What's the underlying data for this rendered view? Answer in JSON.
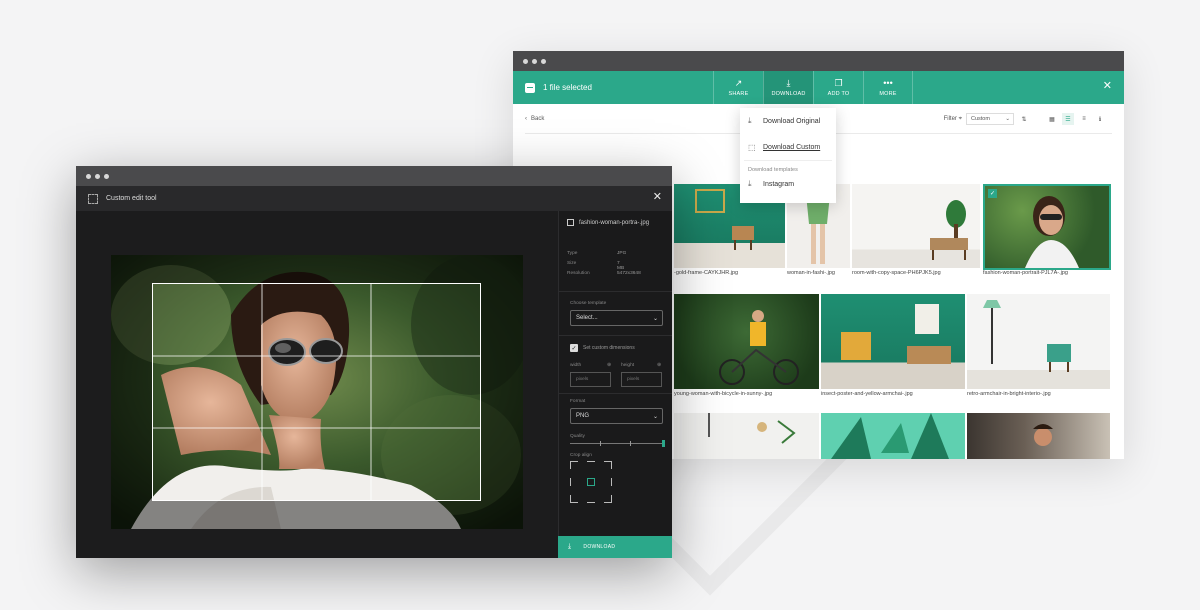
{
  "gallery": {
    "selection_text": "1 file selected",
    "actions": [
      {
        "label": "SHARE",
        "icon": "share-icon"
      },
      {
        "label": "DOWNLOAD",
        "icon": "download-icon"
      },
      {
        "label": "ADD TO",
        "icon": "add-to-icon"
      },
      {
        "label": "MORE",
        "icon": "more-icon"
      }
    ],
    "back_label": "Back",
    "filter_label": "Filter",
    "sort_select_value": "Custom",
    "download_menu": {
      "original": "Download Original",
      "custom": "Download Custom",
      "templates_heading": "Download templates",
      "template_item": "Instagram"
    },
    "items": [
      {
        "caption": "-gold-frame-CAYKJHR.jpg"
      },
      {
        "caption": "woman-in-fashi-.jpg"
      },
      {
        "caption": "room-with-copy-space-PH6PJK5.jpg"
      },
      {
        "caption": "fashion-woman-portrait-PJL7A-.jpg"
      },
      {
        "caption": "young-woman-with-bicycle-in-sunny-.jpg"
      },
      {
        "caption": "insect-poster-and-yellow-armchai-.jpg"
      },
      {
        "caption": "retro-armchair-in-bright-interio-.jpg"
      }
    ]
  },
  "editor": {
    "title": "Custom edit tool",
    "file_name": "fashion-woman-portra-.jpg",
    "meta": [
      {
        "label": "Type",
        "value": "JPG"
      },
      {
        "label": "Size",
        "value": "7 MB"
      },
      {
        "label": "Resolution",
        "value": "5472x3648"
      }
    ],
    "template_label": "Choose template",
    "template_value": "Select...",
    "custom_dimensions_label": "Set custom dimensions",
    "width_label": "width",
    "height_label": "height",
    "width_placeholder": "pixels",
    "height_placeholder": "pixels",
    "format_label": "Format",
    "format_value": "PNG",
    "quality_label": "Quality",
    "crop_align_label": "Crop align",
    "download_label": "DOWNLOAD"
  },
  "colors": {
    "accent": "#2ba88a",
    "editor_bg": "#1c1c1d",
    "titlebar": "#4a4a4c"
  }
}
